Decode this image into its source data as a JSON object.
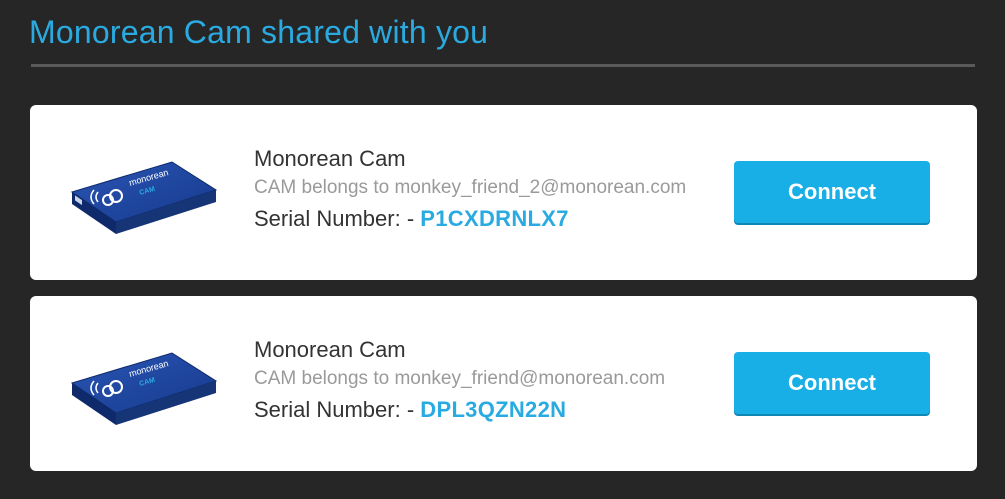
{
  "page": {
    "title": "Monorean Cam shared with you"
  },
  "cams": [
    {
      "name": "Monorean Cam",
      "owner": "CAM belongs to monkey_friend_2@monorean.com",
      "serial_label": "Serial Number: - ",
      "serial": "P1CXDRNLX7",
      "connect_label": "Connect",
      "device_brand": "monorean",
      "device_model": "CAM"
    },
    {
      "name": "Monorean Cam",
      "owner": "CAM belongs to monkey_friend@monorean.com",
      "serial_label": "Serial Number: - ",
      "serial": "DPL3QZN22N",
      "connect_label": "Connect",
      "device_brand": "monorean",
      "device_model": "CAM"
    }
  ],
  "colors": {
    "background": "#262626",
    "accent": "#29abe2",
    "button": "#18aee6",
    "device_blue": "#1f3f8f"
  }
}
